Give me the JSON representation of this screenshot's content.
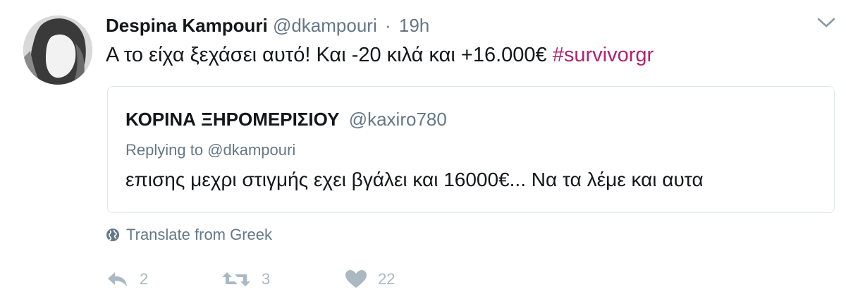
{
  "tweet": {
    "author": {
      "name": "Despina Kampouri",
      "handle": "@dkampouri",
      "separator": "·",
      "time": "19h"
    },
    "text_main": "Α το είχα ξεχάσει αυτό! Και -20 κιλά και +16.000€ ",
    "hashtag": "#survivorgr",
    "quoted": {
      "name": "ΚΟΡΙΝΑ ΞΗΡΟΜΕΡΙΣΙΟΥ",
      "handle": "@kaxiro780",
      "replying_to": "Replying to @dkampouri",
      "text": "επισης μεχρι στιγμής εχει βγάλει και 16000€... Να τα λέμε και αυτα"
    },
    "translate_label": "Translate from Greek",
    "actions": {
      "replies": "2",
      "retweets": "3",
      "likes": "22"
    }
  },
  "icons": {
    "more": "chevron-down-icon",
    "globe": "globe-icon",
    "reply": "reply-icon",
    "retweet": "retweet-icon",
    "like": "heart-icon"
  },
  "colors": {
    "hashtag": "#b0236f",
    "secondary_text": "#657786",
    "action_icons": "#aab8c2",
    "quote_border": "#e1e8ed"
  }
}
